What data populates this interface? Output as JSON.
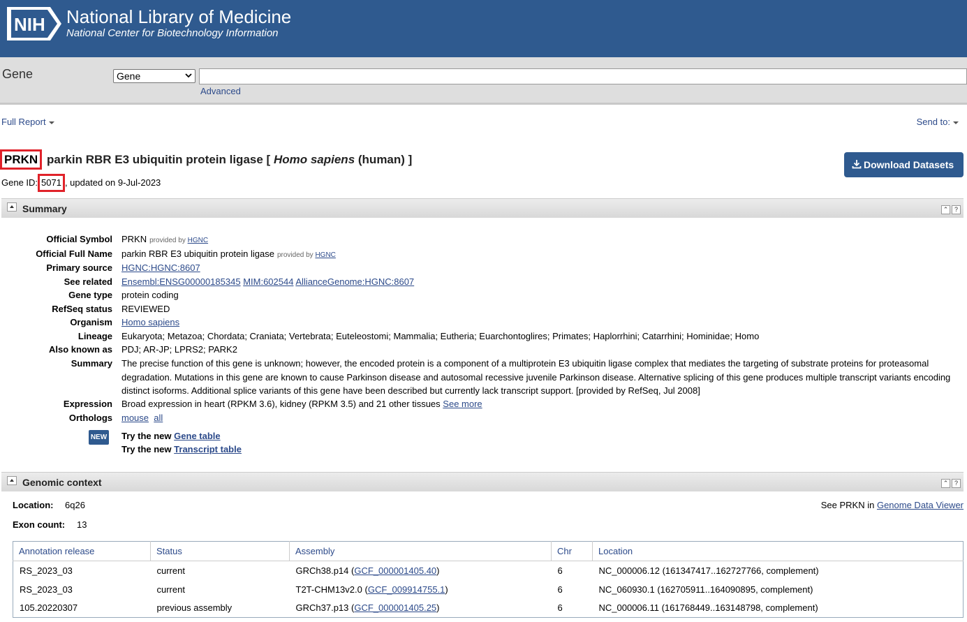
{
  "header": {
    "logo_text": "NIH",
    "title": "National Library of Medicine",
    "subtitle": "National Center for Biotechnology Information"
  },
  "search": {
    "db_label": "Gene",
    "selected_db": "Gene",
    "query": "",
    "advanced_label": "Advanced"
  },
  "toolbar": {
    "full_report": "Full Report",
    "send_to": "Send to:"
  },
  "gene": {
    "symbol": "PRKN",
    "name": "parkin RBR E3 ubiquitin protein ligase",
    "bracket_open": "[",
    "organism_italic": "Homo sapiens",
    "organism_common": "(human)",
    "bracket_close": "]",
    "id_label": "Gene ID:",
    "id": "5071",
    "updated": ", updated on 9-Jul-2023"
  },
  "download_button": "Download Datasets",
  "summary": {
    "section_title": "Summary",
    "provided_by": "provided by",
    "hgnc": "HGNC",
    "official_symbol_label": "Official Symbol",
    "official_symbol": "PRKN",
    "official_full_name_label": "Official Full Name",
    "official_full_name": "parkin RBR E3 ubiquitin protein ligase",
    "primary_source_label": "Primary source",
    "primary_source": "HGNC:HGNC:8607",
    "see_related_label": "See related",
    "see_related": [
      "Ensembl:ENSG00000185345",
      "MIM:602544",
      "AllianceGenome:HGNC:8607"
    ],
    "gene_type_label": "Gene type",
    "gene_type": "protein coding",
    "refseq_status_label": "RefSeq status",
    "refseq_status": "REVIEWED",
    "organism_label": "Organism",
    "organism": "Homo sapiens",
    "lineage_label": "Lineage",
    "lineage": "Eukaryota; Metazoa; Chordata; Craniata; Vertebrata; Euteleostomi; Mammalia; Eutheria; Euarchontoglires; Primates; Haplorrhini; Catarrhini; Hominidae; Homo",
    "aka_label": "Also known as",
    "aka": "PDJ; AR-JP; LPRS2; PARK2",
    "summary_label": "Summary",
    "summary_text": "The precise function of this gene is unknown; however, the encoded protein is a component of a multiprotein E3 ubiquitin ligase complex that mediates the targeting of substrate proteins for proteasomal degradation. Mutations in this gene are known to cause Parkinson disease and autosomal recessive juvenile Parkinson disease. Alternative splicing of this gene produces multiple transcript variants encoding distinct isoforms. Additional splice variants of this gene have been described but currently lack transcript support. [provided by RefSeq, Jul 2008]",
    "expression_label": "Expression",
    "expression": "Broad expression in heart (RPKM 3.6), kidney (RPKM 3.5) and 21 other tissues",
    "see_more": "See more",
    "orthologs_label": "Orthologs",
    "orthologs": [
      "mouse",
      "all"
    ],
    "new_badge": "NEW",
    "try_new": "Try the new",
    "gene_table": "Gene table",
    "transcript_table": "Transcript table"
  },
  "genomic": {
    "section_title": "Genomic context",
    "location_label": "Location:",
    "location": "6q26",
    "exon_label": "Exon count:",
    "exon_count": "13",
    "see_prefix": "See PRKN in",
    "gdv": "Genome Data Viewer",
    "columns": [
      "Annotation release",
      "Status",
      "Assembly",
      "Chr",
      "Location"
    ],
    "rows": [
      {
        "release": "RS_2023_03",
        "status": "current",
        "assembly": "GRCh38.p14",
        "accession": "GCF_000001405.40",
        "chr": "6",
        "location": "NC_000006.12 (161347417..162727766, complement)"
      },
      {
        "release": "RS_2023_03",
        "status": "current",
        "assembly": "T2T-CHM13v2.0",
        "accession": "GCF_009914755.1",
        "chr": "6",
        "location": "NC_060930.1 (162705911..164090895, complement)"
      },
      {
        "release": "105.20220307",
        "status": "previous assembly",
        "assembly": "GRCh37.p13",
        "accession": "GCF_000001405.25",
        "chr": "6",
        "location": "NC_000006.11 (161768449..163148798, complement)"
      }
    ]
  },
  "colors": {
    "header_bg": "#2f5a8f",
    "highlight_box": "#e0222a",
    "link": "#2c4a8a"
  }
}
